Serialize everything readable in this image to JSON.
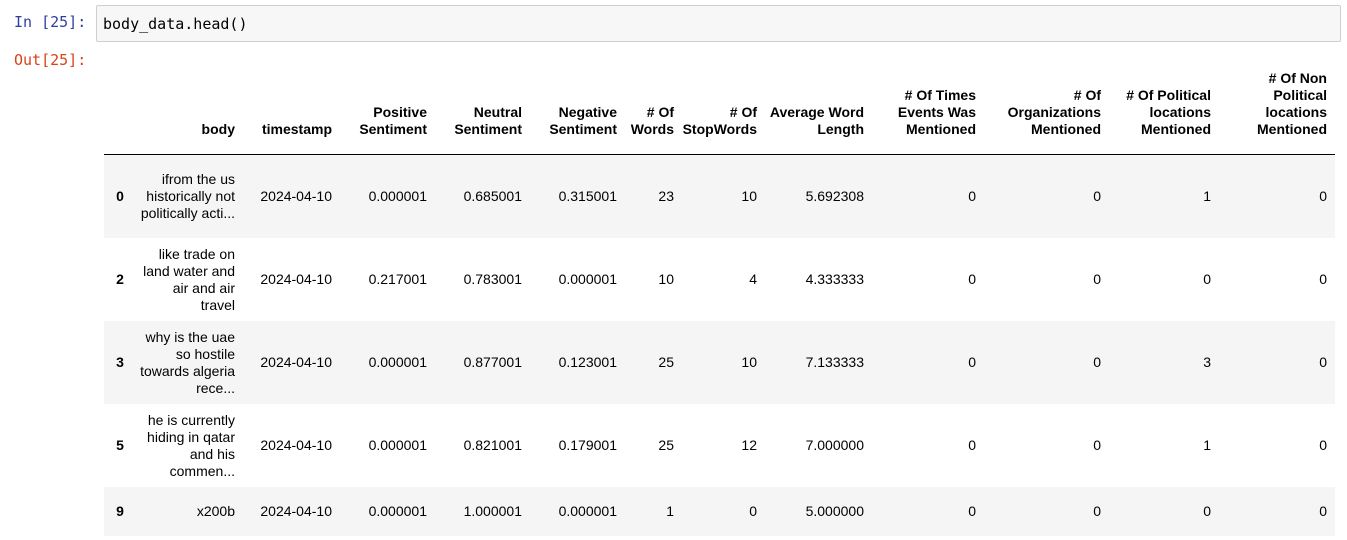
{
  "cell": {
    "in_prompt": "In [25]:",
    "code": "body_data.head()",
    "out_prompt": "Out[25]:"
  },
  "table": {
    "columns": [
      "body",
      "timestamp",
      "Positive Sentiment",
      "Neutral Sentiment",
      "Negative Sentiment",
      "# Of Words",
      "# Of StopWords",
      "Average Word Length",
      "# Of Times Events Was Mentioned",
      "# Of Organizations Mentioned",
      "# Of Political locations Mentioned",
      "# Of Non Political locations Mentioned"
    ],
    "rows": [
      {
        "index": "0",
        "cells": [
          "ifrom the us historically not politically acti...",
          "2024-04-10",
          "0.000001",
          "0.685001",
          "0.315001",
          "23",
          "10",
          "5.692308",
          "0",
          "0",
          "1",
          "0"
        ]
      },
      {
        "index": "2",
        "cells": [
          "like trade on land water and air and air travel",
          "2024-04-10",
          "0.217001",
          "0.783001",
          "0.000001",
          "10",
          "4",
          "4.333333",
          "0",
          "0",
          "0",
          "0"
        ]
      },
      {
        "index": "3",
        "cells": [
          "why is the uae so hostile towards algeria rece...",
          "2024-04-10",
          "0.000001",
          "0.877001",
          "0.123001",
          "25",
          "10",
          "7.133333",
          "0",
          "0",
          "3",
          "0"
        ]
      },
      {
        "index": "5",
        "cells": [
          "he is currently hiding in qatar and his commen...",
          "2024-04-10",
          "0.000001",
          "0.821001",
          "0.179001",
          "25",
          "12",
          "7.000000",
          "0",
          "0",
          "1",
          "0"
        ]
      },
      {
        "index": "9",
        "cells": [
          "x200b",
          "2024-04-10",
          "0.000001",
          "1.000001",
          "0.000001",
          "1",
          "0",
          "5.000000",
          "0",
          "0",
          "0",
          "0"
        ]
      }
    ]
  }
}
